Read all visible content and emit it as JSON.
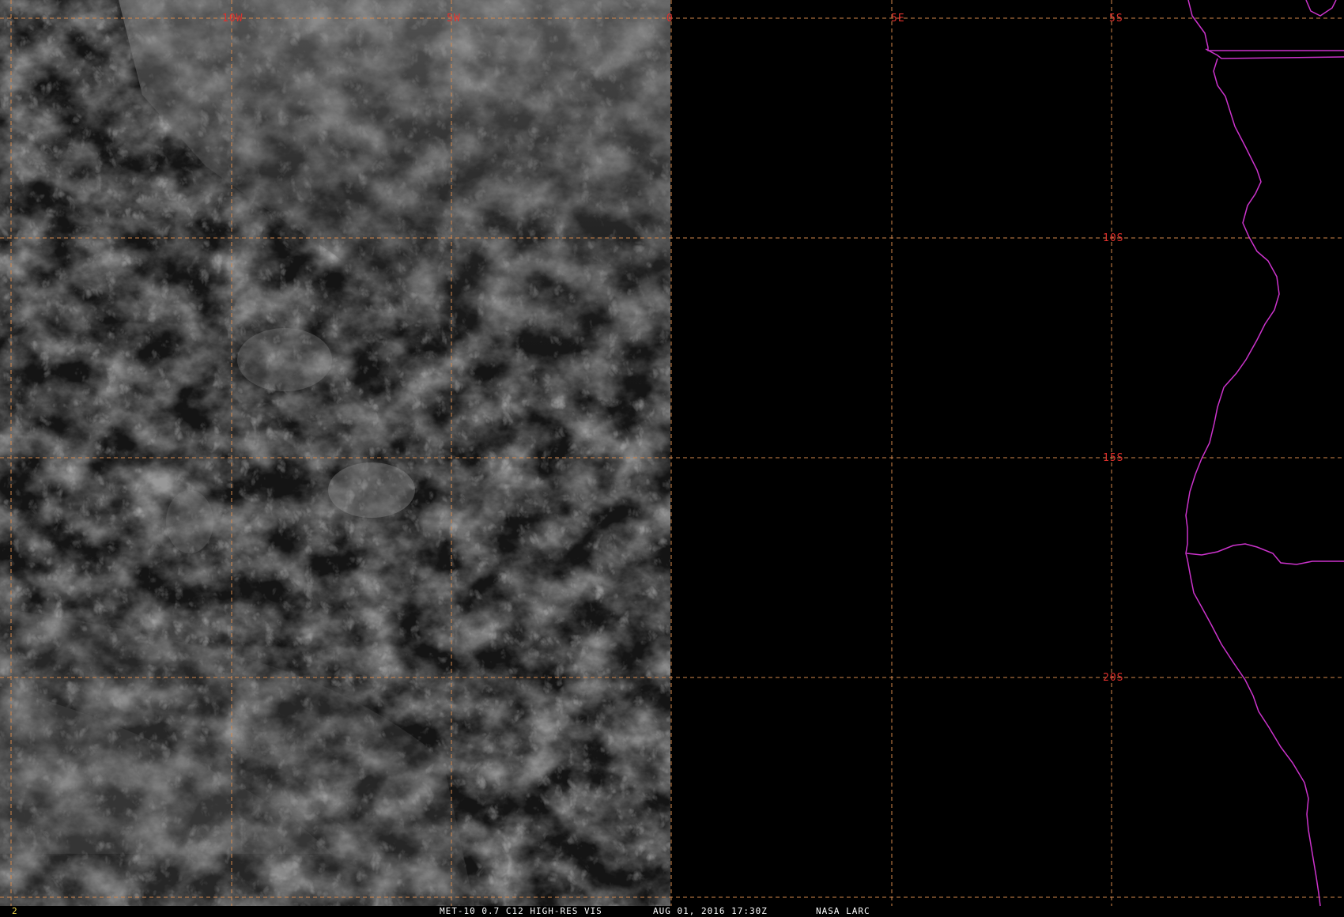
{
  "image": {
    "frame_number": "2",
    "satellite_info": "MET-10 0.7 C12 HIGH-RES VIS",
    "datetime": "AUG 01, 2016 17:30Z",
    "organization": "NASA LARC"
  },
  "grid": {
    "longitude_labels": [
      "10W",
      "5W",
      "0",
      "5E"
    ],
    "latitude_labels": [
      "5S",
      "10S",
      "15S",
      "20S"
    ],
    "line_color": "#d4874a",
    "label_color": "#e0302c"
  },
  "map": {
    "coastline_color": "#cc33cc",
    "clouds_coverage": "western half of image",
    "background": "#000000"
  }
}
